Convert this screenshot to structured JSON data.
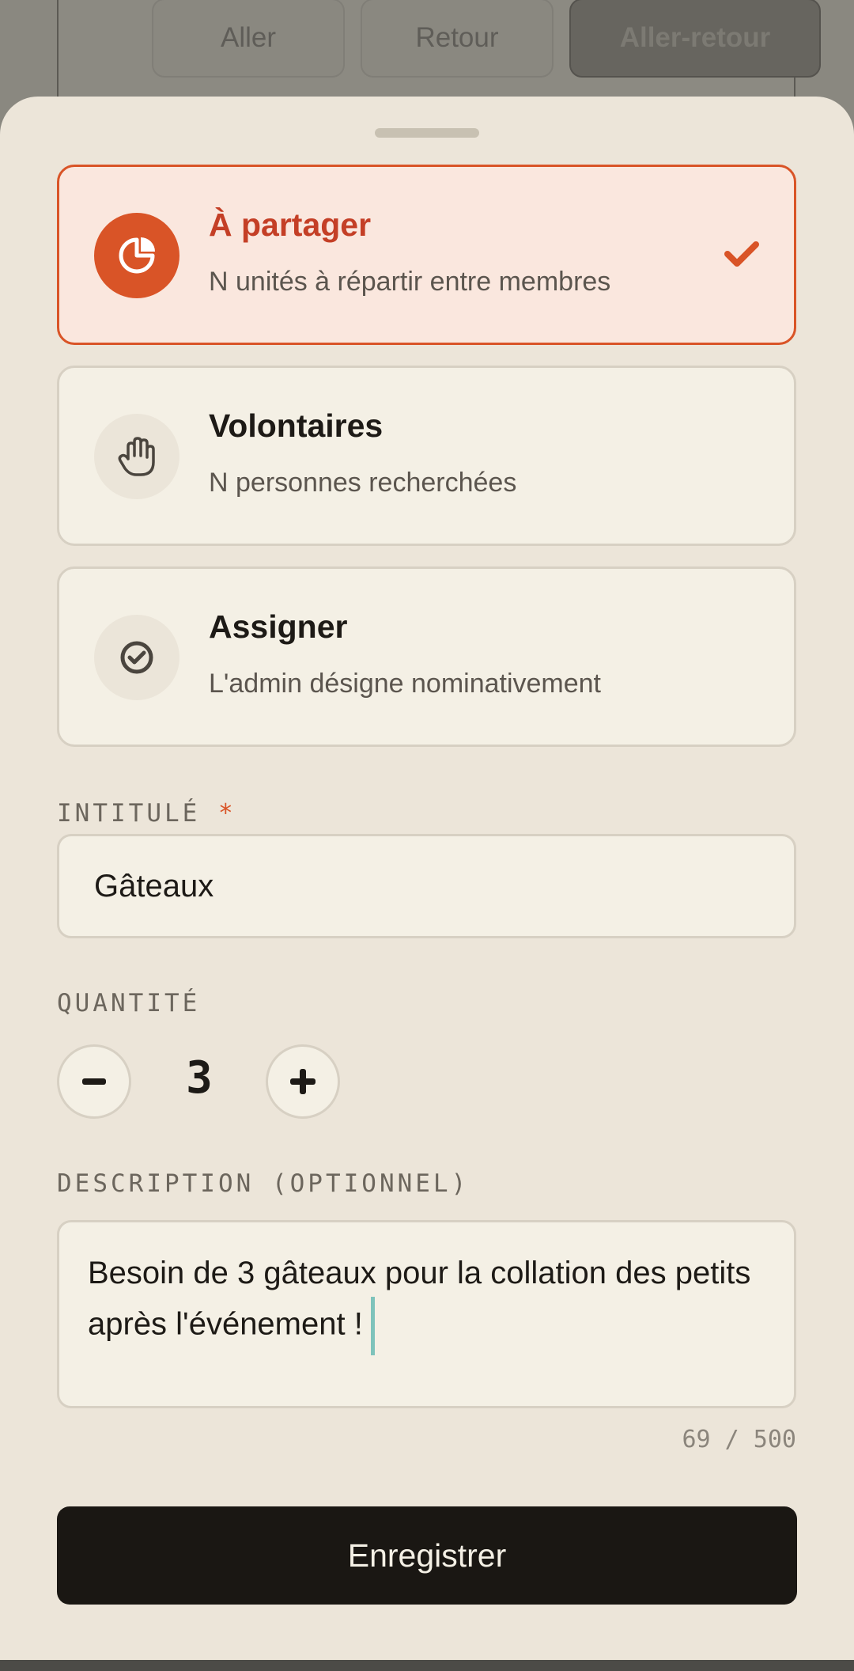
{
  "background": {
    "trip_tabs": [
      {
        "label": "Aller",
        "selected": false
      },
      {
        "label": "Retour",
        "selected": false
      },
      {
        "label": "Aller-retour",
        "selected": true
      }
    ]
  },
  "sheet": {
    "options": [
      {
        "title": "À partager",
        "subtitle": "N unités à répartir entre membres",
        "icon": "pie-chart-icon",
        "selected": true
      },
      {
        "title": "Volontaires",
        "subtitle": "N personnes recherchées",
        "icon": "hand-icon",
        "selected": false
      },
      {
        "title": "Assigner",
        "subtitle": "L'admin désigne nominativement",
        "icon": "check-circle-icon",
        "selected": false
      }
    ],
    "title_field": {
      "label": "INTITULÉ",
      "required_mark": "*",
      "value": "Gâteaux"
    },
    "quantity": {
      "label": "QUANTITÉ",
      "value": "3",
      "decrement": "−",
      "increment": "+"
    },
    "description": {
      "label": "DESCRIPTION (OPTIONNEL)",
      "value": "Besoin de 3 gâteaux pour la collation des petits après l'événement !",
      "char_count": "69 / 500"
    },
    "save_label": "Enregistrer"
  },
  "colors": {
    "accent": "#d95427",
    "selected_bg": "#fae7de",
    "sheet_bg": "#ece5d9",
    "card_bg": "#f4f0e5",
    "primary_button": "#1a1713"
  }
}
